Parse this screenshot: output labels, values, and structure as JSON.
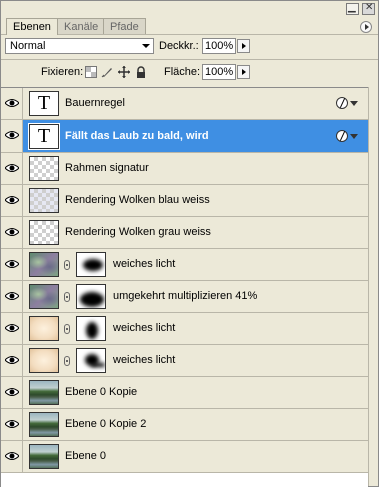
{
  "tabs": [
    {
      "label": "Ebenen",
      "active": true
    },
    {
      "label": "Kanäle",
      "active": false
    },
    {
      "label": "Pfade",
      "active": false
    }
  ],
  "blend_mode": "Normal",
  "opacity": {
    "label": "Deckkr.:",
    "value": "100%"
  },
  "lock": {
    "label": "Fixieren:"
  },
  "fill": {
    "label": "Fläche:",
    "value": "100%"
  },
  "layers": [
    {
      "name": "Bauernregel",
      "thumb": "text",
      "thumb_char": "T",
      "fx": true,
      "selected": false
    },
    {
      "name": "Fällt das Laub  zu bald, wird",
      "thumb": "text",
      "thumb_char": "T",
      "fx": true,
      "selected": true
    },
    {
      "name": "Rahmen signatur",
      "thumb": "checker",
      "selected": false
    },
    {
      "name": "Rendering Wolken blau weiss",
      "thumb": "checker-blue",
      "selected": false
    },
    {
      "name": "Rendering Wolken grau weiss",
      "thumb": "checker",
      "selected": false
    },
    {
      "name": "weiches licht",
      "thumb": "photo",
      "mask": true,
      "selected": false
    },
    {
      "name": "umgekehrt multiplizieren 41%",
      "thumb": "photo",
      "mask": true,
      "selected": false
    },
    {
      "name": "weiches licht",
      "thumb": "beige",
      "mask": true,
      "selected": false
    },
    {
      "name": "weiches licht",
      "thumb": "beige",
      "mask": true,
      "selected": false
    },
    {
      "name": "Ebene 0 Kopie",
      "thumb": "forest",
      "selected": false
    },
    {
      "name": "Ebene 0 Kopie 2",
      "thumb": "forest",
      "selected": false
    },
    {
      "name": "Ebene 0",
      "thumb": "forest",
      "selected": false
    }
  ],
  "colors": {
    "selection": "#3f8fe3",
    "panel": "#ece9d8"
  }
}
